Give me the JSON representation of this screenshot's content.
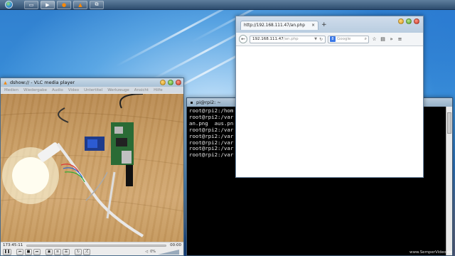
{
  "taskbar": {
    "buttons": [
      {
        "icon": "folder-icon"
      },
      {
        "icon": "media-player-icon"
      },
      {
        "icon": "firefox-icon"
      },
      {
        "icon": "vlc-cone-icon"
      },
      {
        "icon": "network-icon"
      }
    ]
  },
  "vlc": {
    "title": "dshow:// - VLC media player",
    "menu": [
      "Medien",
      "Wiedergabe",
      "Audio",
      "Video",
      "Untertitel",
      "Werkzeuge",
      "Ansicht",
      "Hilfe"
    ],
    "elapsed": "173:45:11",
    "remaining": "00:00",
    "volume": "0%",
    "volume_fraction": 0.0,
    "seek_fraction": 0.0
  },
  "terminal": {
    "title": "pi@rpi2: ~",
    "lines": [
      "root@rpi2:/hom",
      "root@rpi2:/var",
      "an.png  aus.pn",
      "root@rpi2:/var",
      "root@rpi2:/var",
      "root@rpi2:/var",
      "root@rpi2:/var",
      "root@rpi2:/var"
    ]
  },
  "firefox": {
    "tab_title": "http://192.168.111.47/an.php",
    "new_tab": "+",
    "url_host": "192.168.111.47",
    "url_path": "/an.php",
    "search_placeholder": "Google",
    "search_engine_letter": "8"
  },
  "watermark": "www.SemperVideo.de",
  "colors": {
    "accent": "#2f7fcf",
    "terminal_bg": "#000000",
    "terminal_fg": "#e8e8e8"
  }
}
